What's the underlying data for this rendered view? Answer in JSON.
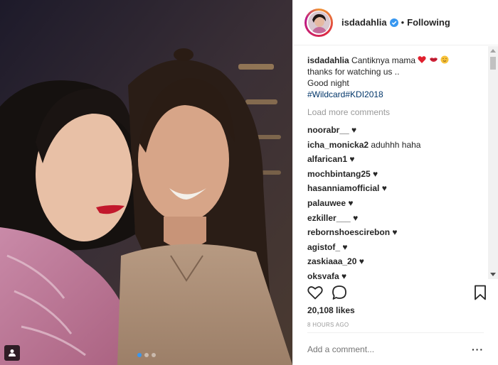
{
  "post": {
    "username": "isdadahlia",
    "follow_status": "Following",
    "separator": "•"
  },
  "caption": {
    "username": "isdadahlia",
    "line1": "Cantiknya mama",
    "line2": "thanks for watching us ..",
    "line3": "Good night",
    "hashtags": "#Wildcard#KDI2018"
  },
  "comments": {
    "load_more": "Load more comments",
    "items": [
      {
        "user": "noorabr__",
        "text": "♥"
      },
      {
        "user": "icha_monicka2",
        "text": "aduhhh haha"
      },
      {
        "user": "alfarican1",
        "text": "♥"
      },
      {
        "user": "mochbintang25",
        "text": "♥"
      },
      {
        "user": "hasanniamofficial",
        "text": "♥"
      },
      {
        "user": "palauwee",
        "text": "♥"
      },
      {
        "user": "ezkiller___",
        "text": "♥"
      },
      {
        "user": "rebornshoescirebon",
        "text": "♥"
      },
      {
        "user": "agistof_",
        "text": "♥"
      },
      {
        "user": "zaskiaaa_20",
        "text": "♥"
      },
      {
        "user": "oksyafa",
        "text": "♥"
      }
    ]
  },
  "stats": {
    "likes": "20,108 likes",
    "time": "8 HOURS AGO"
  },
  "add_comment": {
    "placeholder": "Add a comment...",
    "more": "···"
  },
  "carousel": {
    "count": 3,
    "active": 0
  },
  "colors": {
    "accent": "#3897f0",
    "hashtag": "#003569",
    "muted": "#999999"
  }
}
